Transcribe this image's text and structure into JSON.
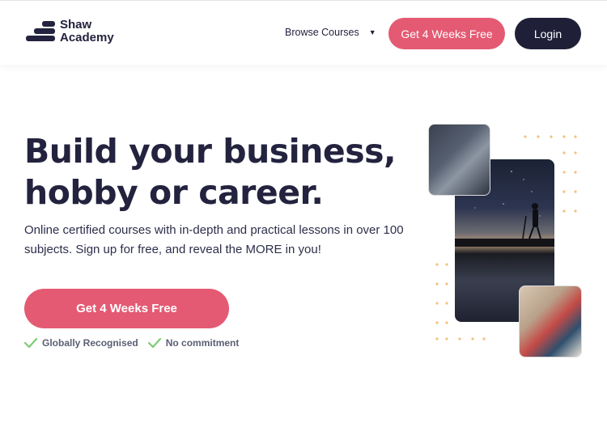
{
  "header": {
    "logo_text_line1": "Shaw",
    "logo_text_line2": "Academy",
    "browse_label": "Browse Courses",
    "cta_label": "Get 4 Weeks Free",
    "login_label": "Login"
  },
  "hero": {
    "title_line1": "Build your business,",
    "title_line2": "hobby or career.",
    "subtitle": "Online certified courses with in-depth and practical lessons in over 100 subjects. Sign up for free, and reveal the MORE in you!",
    "cta_label": "Get 4 Weeks Free",
    "badges": [
      "Globally Recognised",
      "No commitment"
    ]
  },
  "colors": {
    "accent": "#e45a73",
    "dark": "#1f2038",
    "check": "#7ecb74",
    "dots": "#f1c27d"
  },
  "icons": {
    "logo": "shaw-academy-logo-icon",
    "caret": "caret-down-icon",
    "check": "check-icon"
  }
}
